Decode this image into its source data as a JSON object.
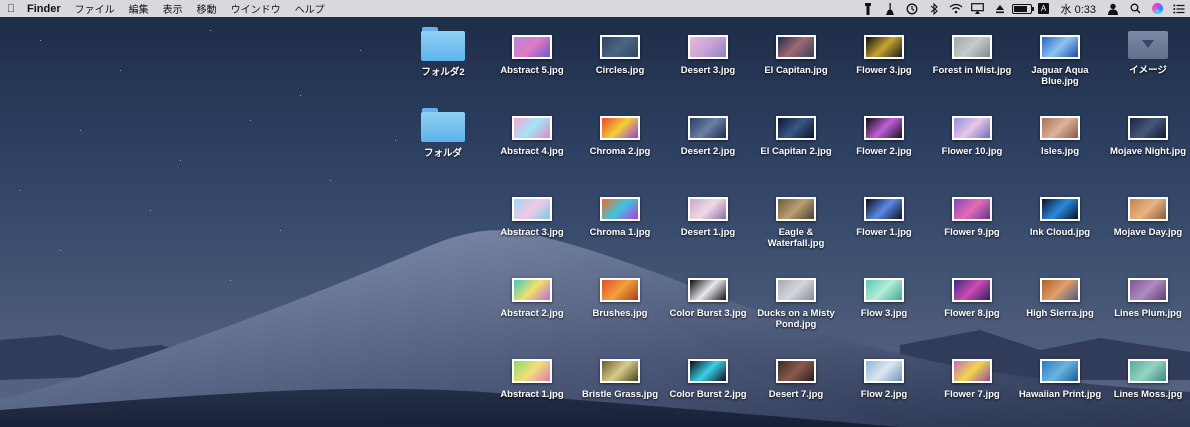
{
  "menubar": {
    "apple_icon": "apple-logo-icon",
    "app_name": "Finder",
    "menus": [
      "ファイル",
      "編集",
      "表示",
      "移動",
      "ウインドウ",
      "ヘルプ"
    ],
    "clock": "水 0:33",
    "input_source": "A",
    "status_icons": [
      "flashlight-icon",
      "broom-icon",
      "time-machine-icon",
      "bluetooth-icon",
      "wifi-icon",
      "airplay-icon",
      "eject-icon",
      "battery-icon",
      "input-source-icon",
      "user-icon",
      "spotlight-icon",
      "siri-icon",
      "notification-center-icon"
    ]
  },
  "desktop": {
    "items": [
      {
        "label": "フォルダ2",
        "kind": "folder"
      },
      {
        "label": "Abstract 5.jpg",
        "kind": "image",
        "colors": [
          "#b08ad8",
          "#e07ac0",
          "#6a5ad0"
        ]
      },
      {
        "label": "Circles.jpg",
        "kind": "image",
        "colors": [
          "#2d4560",
          "#4a6585",
          "#30475f"
        ]
      },
      {
        "label": "Desert 3.jpg",
        "kind": "image",
        "colors": [
          "#e6b9d9",
          "#c9a3d6",
          "#8d7fc4"
        ]
      },
      {
        "label": "El Capitan.jpg",
        "kind": "image",
        "colors": [
          "#1e2c4a",
          "#a06a70",
          "#33425f"
        ]
      },
      {
        "label": "Flower 3.jpg",
        "kind": "image",
        "colors": [
          "#0b0b0b",
          "#c6a530",
          "#1a1a1a"
        ]
      },
      {
        "label": "Forest in Mist.jpg",
        "kind": "image",
        "colors": [
          "#9da7a9",
          "#c6cccb",
          "#7f8a88"
        ]
      },
      {
        "label": "Jaguar Aqua Blue.jpg",
        "kind": "image",
        "colors": [
          "#2c63c6",
          "#8fc4f1",
          "#1e4aa4"
        ]
      },
      {
        "label": "イメージ",
        "kind": "image-folder"
      },
      {
        "label": "フォルダ",
        "kind": "folder"
      },
      {
        "label": "Abstract 4.jpg",
        "kind": "image",
        "colors": [
          "#f2a6d6",
          "#a4e4f6",
          "#e088c5"
        ]
      },
      {
        "label": "Chroma 2.jpg",
        "kind": "image",
        "colors": [
          "#e84a2f",
          "#f1cf33",
          "#9b3be0"
        ]
      },
      {
        "label": "Desert 2.jpg",
        "kind": "image",
        "colors": [
          "#2b3e5e",
          "#6a7ea6",
          "#1e2f4b"
        ]
      },
      {
        "label": "El Capitan 2.jpg",
        "kind": "image",
        "colors": [
          "#0c1830",
          "#3a5785",
          "#0a1326"
        ]
      },
      {
        "label": "Flower 2.jpg",
        "kind": "image",
        "colors": [
          "#0b0b10",
          "#c05fd9",
          "#151520"
        ]
      },
      {
        "label": "Flower 10.jpg",
        "kind": "image",
        "colors": [
          "#8c8fd9",
          "#e8c6e8",
          "#6a6ec0"
        ]
      },
      {
        "label": "Isles.jpg",
        "kind": "image",
        "colors": [
          "#a4725c",
          "#dcb496",
          "#865846"
        ]
      },
      {
        "label": "Mojave Night.jpg",
        "kind": "image",
        "colors": [
          "#1a2540",
          "#46587c",
          "#121a30"
        ]
      },
      {
        "label": "Abstract 3.jpg",
        "kind": "image",
        "colors": [
          "#9ad8f2",
          "#f2c9e6",
          "#7fc9ea"
        ]
      },
      {
        "label": "Chroma 1.jpg",
        "kind": "image",
        "colors": [
          "#f06a2a",
          "#3ec6e0",
          "#b33cd9"
        ]
      },
      {
        "label": "Desert 1.jpg",
        "kind": "image",
        "colors": [
          "#c9a7c9",
          "#f2d9e6",
          "#8a6fa8"
        ]
      },
      {
        "label": "Eagle & Waterfall.jpg",
        "kind": "image",
        "colors": [
          "#6a5a40",
          "#b8a070",
          "#4a3e2c"
        ]
      },
      {
        "label": "Flower 1.jpg",
        "kind": "image",
        "colors": [
          "#0a0a16",
          "#5a8ae8",
          "#101020"
        ]
      },
      {
        "label": "Flower 9.jpg",
        "kind": "image",
        "colors": [
          "#7a4ab0",
          "#e86ab8",
          "#5a3a90"
        ]
      },
      {
        "label": "Ink Cloud.jpg",
        "kind": "image",
        "colors": [
          "#0a1428",
          "#2a8ae0",
          "#08101e"
        ]
      },
      {
        "label": "Mojave Day.jpg",
        "kind": "image",
        "colors": [
          "#c8814a",
          "#e8b482",
          "#8a5a3a"
        ]
      },
      {
        "label": "Abstract 2.jpg",
        "kind": "image",
        "colors": [
          "#3cc8c0",
          "#f2e06a",
          "#c06ad8"
        ]
      },
      {
        "label": "Brushes.jpg",
        "kind": "image",
        "colors": [
          "#e0502a",
          "#f2a03a",
          "#b03a20"
        ]
      },
      {
        "label": "Color Burst 3.jpg",
        "kind": "image",
        "colors": [
          "#0a0a0a",
          "#e8e8f0",
          "#141414"
        ]
      },
      {
        "label": "Ducks on a Misty Pond.jpg",
        "kind": "image",
        "colors": [
          "#a8aab4",
          "#d4d6dc",
          "#8a8c96"
        ]
      },
      {
        "label": "Flow 3.jpg",
        "kind": "image",
        "colors": [
          "#5ac8b4",
          "#b4ecd8",
          "#3aa894"
        ]
      },
      {
        "label": "Flower 8.jpg",
        "kind": "image",
        "colors": [
          "#3a2a8a",
          "#d04ab0",
          "#2a1e6a"
        ]
      },
      {
        "label": "High Sierra.jpg",
        "kind": "image",
        "colors": [
          "#b0602a",
          "#e0a06a",
          "#4a5a80"
        ]
      },
      {
        "label": "Lines Plum.jpg",
        "kind": "image",
        "colors": [
          "#7a5a90",
          "#b08ac4",
          "#5a4070"
        ]
      },
      {
        "label": "Abstract 1.jpg",
        "kind": "image",
        "colors": [
          "#8ad86a",
          "#f2e07a",
          "#e07ab0"
        ]
      },
      {
        "label": "Bristle Grass.jpg",
        "kind": "image",
        "colors": [
          "#6a5a30",
          "#d8cc8a",
          "#4a3e20"
        ]
      },
      {
        "label": "Color Burst 2.jpg",
        "kind": "image",
        "colors": [
          "#0a0a14",
          "#3ad0e8",
          "#101020"
        ]
      },
      {
        "label": "Desert 7.jpg",
        "kind": "image",
        "colors": [
          "#3a2a2a",
          "#8a5a4a",
          "#2a1e1e"
        ]
      },
      {
        "label": "Flow 2.jpg",
        "kind": "image",
        "colors": [
          "#8ab4d8",
          "#dce8f2",
          "#6a94c0"
        ]
      },
      {
        "label": "Flower 7.jpg",
        "kind": "image",
        "colors": [
          "#c06ac0",
          "#f2d84a",
          "#9a4aa0"
        ]
      },
      {
        "label": "Hawaiian Print.jpg",
        "kind": "image",
        "colors": [
          "#2a7ac0",
          "#6ab4e0",
          "#1e5a98"
        ]
      },
      {
        "label": "Lines Moss.jpg",
        "kind": "image",
        "colors": [
          "#5aa89a",
          "#94d4c4",
          "#3a8a7c"
        ]
      }
    ]
  }
}
